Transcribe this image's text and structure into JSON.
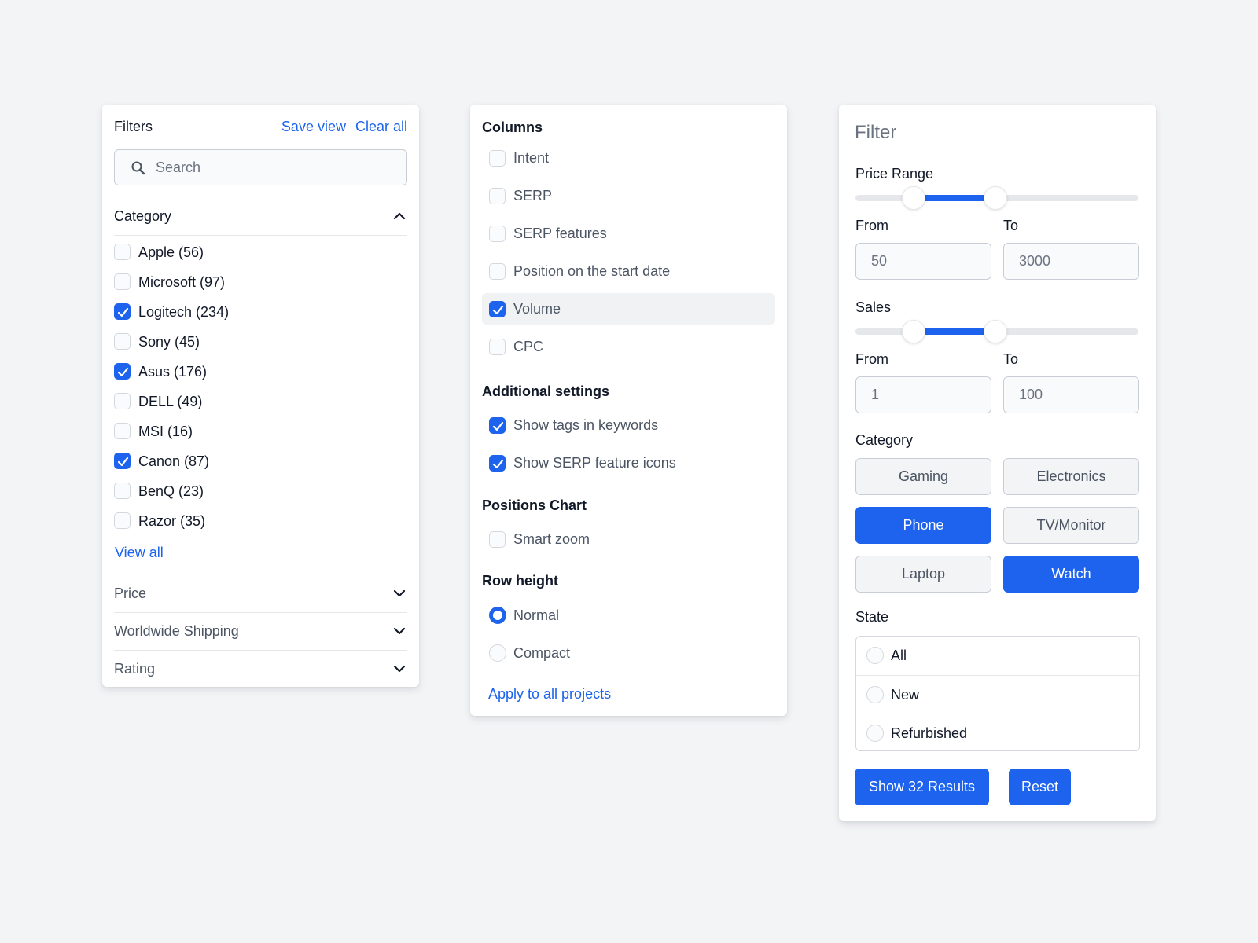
{
  "panel1": {
    "title": "Filters",
    "save_view": "Save view",
    "clear_all": "Clear all",
    "search_placeholder": "Search",
    "category_label": "Category",
    "categories": [
      {
        "label": "Apple (56)",
        "checked": false
      },
      {
        "label": "Microsoft (97)",
        "checked": false
      },
      {
        "label": "Logitech (234)",
        "checked": true
      },
      {
        "label": "Sony (45)",
        "checked": false
      },
      {
        "label": "Asus (176)",
        "checked": true
      },
      {
        "label": "DELL (49)",
        "checked": false
      },
      {
        "label": "MSI (16)",
        "checked": false
      },
      {
        "label": "Canon (87)",
        "checked": true
      },
      {
        "label": "BenQ (23)",
        "checked": false
      },
      {
        "label": "Razor (35)",
        "checked": false
      }
    ],
    "view_all": "View all",
    "sections": [
      "Price",
      "Worldwide Shipping",
      "Rating"
    ]
  },
  "panel2": {
    "columns_title": "Columns",
    "columns": [
      {
        "label": "Intent",
        "checked": false
      },
      {
        "label": "SERP",
        "checked": false
      },
      {
        "label": "SERP features",
        "checked": false
      },
      {
        "label": "Position on the start date",
        "checked": false
      },
      {
        "label": "Volume",
        "checked": true
      },
      {
        "label": "CPC",
        "checked": false
      }
    ],
    "additional_title": "Additional settings",
    "additional": [
      {
        "label": "Show tags in keywords",
        "checked": true
      },
      {
        "label": "Show SERP feature icons",
        "checked": true
      }
    ],
    "positions_title": "Positions Chart",
    "positions": [
      {
        "label": "Smart zoom",
        "checked": false
      }
    ],
    "row_height_title": "Row height",
    "row_height": [
      {
        "label": "Normal",
        "selected": true
      },
      {
        "label": "Compact",
        "selected": false
      }
    ],
    "apply": "Apply to all projects"
  },
  "panel3": {
    "title": "Filter",
    "price_range": {
      "label": "Price Range",
      "from_label": "From",
      "to_label": "To",
      "from": "50",
      "to": "3000",
      "low_fraction": 0.205,
      "high_fraction": 0.495
    },
    "sales": {
      "label": "Sales",
      "from_label": "From",
      "to_label": "To",
      "from": "1",
      "to": "100",
      "low_fraction": 0.205,
      "high_fraction": 0.495
    },
    "category_label": "Category",
    "categories": [
      {
        "label": "Gaming",
        "selected": false
      },
      {
        "label": "Electronics",
        "selected": false
      },
      {
        "label": "Phone",
        "selected": true
      },
      {
        "label": "TV/Monitor",
        "selected": false
      },
      {
        "label": "Laptop",
        "selected": false
      },
      {
        "label": "Watch",
        "selected": true
      }
    ],
    "state_label": "State",
    "states": [
      "All",
      "New",
      "Refurbished"
    ],
    "show_results": "Show 32 Results",
    "reset": "Reset"
  },
  "colors": {
    "accent": "#1d63ed",
    "background": "#f3f4f6",
    "card": "#ffffff"
  },
  "icons": {
    "search": "search-icon",
    "chevron_up": "chevron-up-icon",
    "chevron_down": "chevron-down-icon",
    "check": "checkmark-icon"
  }
}
